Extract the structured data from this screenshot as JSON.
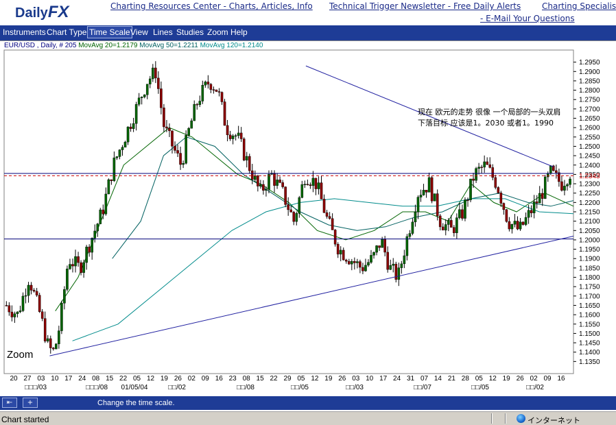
{
  "header": {
    "logo_daily": "Daily",
    "logo_fx": "FX",
    "links": [
      "Charting Resources Center - Charts, Articles, Info",
      "Technical Trigger Newsletter - Free Daily Alerts",
      "Charting Specialist",
      "- E-Mail Your Questions"
    ]
  },
  "menu": {
    "items": [
      "Instruments",
      "Chart Type",
      "Time Scale",
      "View",
      "Lines",
      "Studies",
      "Zoom",
      "Help"
    ],
    "active": "Time Scale"
  },
  "legend": {
    "symbol": "EUR/USD , Daily, # 205",
    "ma20": "MovAvg 20=1.2179",
    "ma50": "MovAvg 50=1.2211",
    "ma120": "MovAvg 120=1.2140"
  },
  "annotation": "现在 欧元的走势 很像 一个局部的一头双肩  下落目标 应该是1。2030 或者1。1990",
  "zoom_label": "Zoom",
  "chart_data": {
    "type": "candlestick",
    "instrument": "EUR/USD",
    "timeframe": "Daily",
    "bar_count": 205,
    "ylim": [
      1.13,
      1.3
    ],
    "y_ticks": [
      1.135,
      1.14,
      1.145,
      1.15,
      1.155,
      1.16,
      1.165,
      1.17,
      1.175,
      1.18,
      1.185,
      1.19,
      1.195,
      1.2,
      1.205,
      1.21,
      1.215,
      1.22,
      1.225,
      1.23,
      1.235,
      1.24,
      1.245,
      1.25,
      1.255,
      1.26,
      1.265,
      1.27,
      1.275,
      1.28,
      1.285,
      1.29,
      1.295
    ],
    "y_tick_labels": [
      "1.1350",
      "1.1400",
      "1.1450",
      "1.1500",
      "1.1550",
      "1.1600",
      "1.1650",
      "1.1700",
      "1.1750",
      "1.1800",
      "1.1850",
      "1.1900",
      "1.1950",
      "1.2000",
      "1.2050",
      "1.2100",
      "1.2150",
      "1.2200",
      "1.2250",
      "1.2300",
      "1.2350",
      "1.2400",
      "1.2450",
      "1.2500",
      "1.2550",
      "1.2600",
      "1.2650",
      "1.2700",
      "1.2750",
      "1.2800",
      "1.2850",
      "1.2900",
      "1.2950"
    ],
    "x_tick_labels": [
      "20",
      "27",
      "03",
      "10",
      "17",
      "24",
      "08",
      "15",
      "22",
      "05",
      "12",
      "19",
      "26",
      "02",
      "09",
      "16",
      "23",
      "08",
      "15",
      "22",
      "29",
      "05",
      "12",
      "19",
      "26",
      "03",
      "10",
      "17",
      "24",
      "31",
      "07",
      "14",
      "21",
      "28",
      "05",
      "12",
      "19",
      "26",
      "02",
      "09",
      "16"
    ],
    "x_month_labels": [
      "□□□/03",
      "□□□/08",
      "01/05/04",
      "□□/02",
      "□□/08",
      "□□/05",
      "□□/03",
      "□□/07",
      "□□/05",
      "□□/02"
    ],
    "current_price": 1.2343,
    "current_price_label": "1.2343",
    "horizontal_lines": [
      1.2355,
      1.2005
    ],
    "trendlines": [
      {
        "name": "upper-resistance",
        "from": [
          0.53,
          1.293
        ],
        "to": [
          0.965,
          1.239
        ]
      },
      {
        "name": "lower-support",
        "from": [
          0.08,
          1.138
        ],
        "to": [
          1.0,
          1.202
        ]
      }
    ],
    "moving_averages": [
      {
        "name": "MovAvg 20",
        "last": 1.2179,
        "color": "#006400"
      },
      {
        "name": "MovAvg 50",
        "last": 1.2211,
        "color": "#006060"
      },
      {
        "name": "MovAvg 120",
        "last": 1.214,
        "color": "#008b8b"
      }
    ],
    "price_path": [
      [
        0.0,
        1.165
      ],
      [
        0.02,
        1.16
      ],
      [
        0.04,
        1.18
      ],
      [
        0.06,
        1.16
      ],
      [
        0.075,
        1.142
      ],
      [
        0.085,
        1.14
      ],
      [
        0.095,
        1.155
      ],
      [
        0.11,
        1.19
      ],
      [
        0.13,
        1.185
      ],
      [
        0.15,
        1.2
      ],
      [
        0.17,
        1.215
      ],
      [
        0.19,
        1.24
      ],
      [
        0.21,
        1.255
      ],
      [
        0.23,
        1.27
      ],
      [
        0.25,
        1.285
      ],
      [
        0.265,
        1.29
      ],
      [
        0.28,
        1.26
      ],
      [
        0.295,
        1.25
      ],
      [
        0.31,
        1.24
      ],
      [
        0.325,
        1.26
      ],
      [
        0.34,
        1.275
      ],
      [
        0.36,
        1.285
      ],
      [
        0.375,
        1.28
      ],
      [
        0.39,
        1.26
      ],
      [
        0.41,
        1.255
      ],
      [
        0.43,
        1.24
      ],
      [
        0.45,
        1.225
      ],
      [
        0.47,
        1.235
      ],
      [
        0.49,
        1.225
      ],
      [
        0.51,
        1.21
      ],
      [
        0.53,
        1.235
      ],
      [
        0.55,
        1.23
      ],
      [
        0.57,
        1.21
      ],
      [
        0.59,
        1.195
      ],
      [
        0.61,
        1.19
      ],
      [
        0.63,
        1.185
      ],
      [
        0.65,
        1.19
      ],
      [
        0.665,
        1.2
      ],
      [
        0.68,
        1.185
      ],
      [
        0.695,
        1.18
      ],
      [
        0.71,
        1.2
      ],
      [
        0.73,
        1.225
      ],
      [
        0.75,
        1.23
      ],
      [
        0.77,
        1.21
      ],
      [
        0.79,
        1.205
      ],
      [
        0.81,
        1.215
      ],
      [
        0.83,
        1.235
      ],
      [
        0.85,
        1.24
      ],
      [
        0.87,
        1.23
      ],
      [
        0.89,
        1.21
      ],
      [
        0.91,
        1.205
      ],
      [
        0.93,
        1.215
      ],
      [
        0.95,
        1.225
      ],
      [
        0.965,
        1.236
      ],
      [
        0.985,
        1.23
      ],
      [
        1.0,
        1.236
      ]
    ],
    "ma20_path": [
      [
        0.09,
        1.162
      ],
      [
        0.13,
        1.18
      ],
      [
        0.17,
        1.21
      ],
      [
        0.21,
        1.24
      ],
      [
        0.25,
        1.25
      ],
      [
        0.29,
        1.26
      ],
      [
        0.33,
        1.255
      ],
      [
        0.37,
        1.245
      ],
      [
        0.41,
        1.235
      ],
      [
        0.45,
        1.23
      ],
      [
        0.5,
        1.22
      ],
      [
        0.55,
        1.205
      ],
      [
        0.6,
        1.2
      ],
      [
        0.65,
        1.205
      ],
      [
        0.7,
        1.215
      ],
      [
        0.74,
        1.215
      ],
      [
        0.78,
        1.21
      ],
      [
        0.82,
        1.23
      ],
      [
        0.86,
        1.22
      ],
      [
        0.9,
        1.215
      ],
      [
        0.95,
        1.225
      ],
      [
        1.0,
        1.218
      ]
    ],
    "ma50_path": [
      [
        0.19,
        1.19
      ],
      [
        0.24,
        1.21
      ],
      [
        0.28,
        1.245
      ],
      [
        0.32,
        1.255
      ],
      [
        0.37,
        1.25
      ],
      [
        0.42,
        1.235
      ],
      [
        0.47,
        1.225
      ],
      [
        0.52,
        1.215
      ],
      [
        0.57,
        1.208
      ],
      [
        0.62,
        1.205
      ],
      [
        0.67,
        1.207
      ],
      [
        0.72,
        1.212
      ],
      [
        0.77,
        1.215
      ],
      [
        0.82,
        1.222
      ],
      [
        0.87,
        1.225
      ],
      [
        0.92,
        1.22
      ],
      [
        0.96,
        1.218
      ],
      [
        1.0,
        1.221
      ]
    ],
    "ma120_path": [
      [
        0.12,
        1.146
      ],
      [
        0.2,
        1.155
      ],
      [
        0.28,
        1.175
      ],
      [
        0.34,
        1.19
      ],
      [
        0.4,
        1.205
      ],
      [
        0.46,
        1.215
      ],
      [
        0.52,
        1.22
      ],
      [
        0.58,
        1.222
      ],
      [
        0.64,
        1.22
      ],
      [
        0.7,
        1.218
      ],
      [
        0.76,
        1.218
      ],
      [
        0.82,
        1.222
      ],
      [
        0.88,
        1.222
      ],
      [
        0.94,
        1.215
      ],
      [
        1.0,
        1.214
      ]
    ]
  },
  "toolbar": {
    "hint": "Change the time scale."
  },
  "statusbar": {
    "text": "Chart started",
    "zone": "インターネット"
  }
}
